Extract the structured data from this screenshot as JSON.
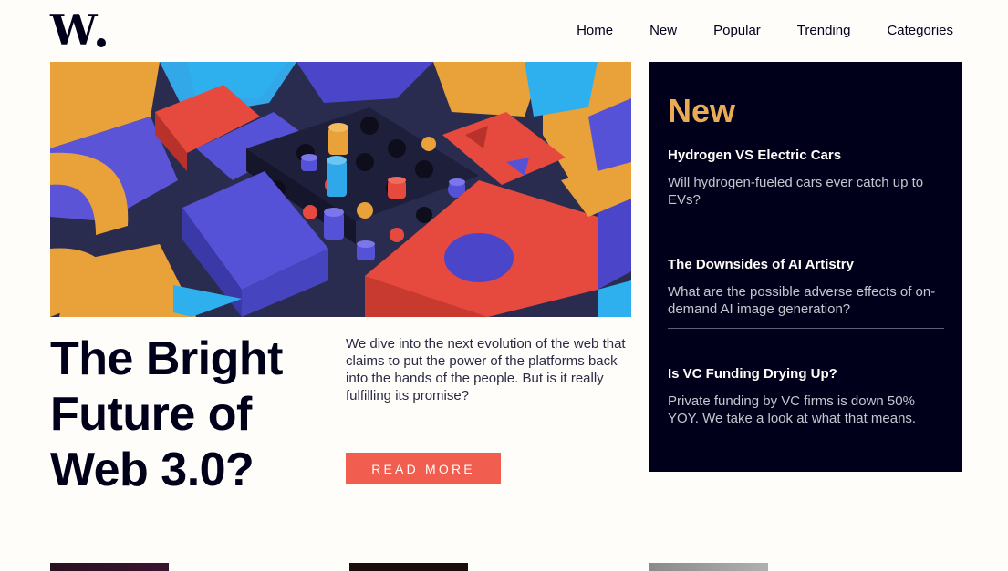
{
  "logo": {
    "text": "W",
    "icon": "logo-dot"
  },
  "nav": {
    "items": [
      {
        "label": "Home"
      },
      {
        "label": "New"
      },
      {
        "label": "Popular"
      },
      {
        "label": "Trending"
      },
      {
        "label": "Categories"
      }
    ]
  },
  "hero": {
    "image_icon": "abstract-3d-blocks-image",
    "title_line1": "The Bright",
    "title_line2": "Future of",
    "title_line3": "Web 3.0?",
    "lead": "We dive into the next evolution of the web that claims to put the power of the platforms back into the hands of the people. But is it really fulfilling its promise?",
    "cta_label": "READ MORE"
  },
  "new_panel": {
    "title": "New",
    "items": [
      {
        "title": "Hydrogen VS Electric Cars",
        "summary": "Will hydrogen-fueled cars ever catch up to EVs?"
      },
      {
        "title": "The Downsides of AI Artistry",
        "summary": "What are the possible adverse effects of on-demand AI image generation?"
      },
      {
        "title": "Is VC Funding Drying Up?",
        "summary": "Private funding by VC firms is down 50% YOY. We take a look at what that means."
      }
    ]
  },
  "colors": {
    "accent_red": "#f15e50",
    "accent_orange": "#e9ab53",
    "dark_navy": "#00001a",
    "off_white": "#fffdfa"
  }
}
